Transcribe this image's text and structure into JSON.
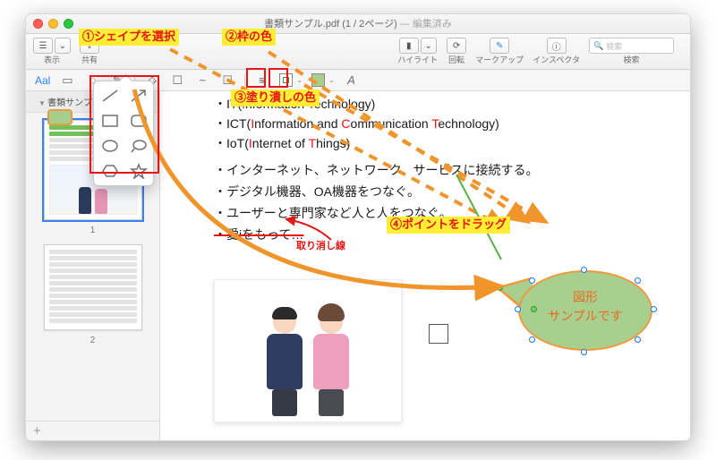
{
  "window": {
    "title_doc": "書類サンプル.pdf",
    "title_pages": "(1 / 2ページ)",
    "title_edited": " — 編集済み"
  },
  "toolbar": {
    "view": "表示",
    "share": "共有",
    "highlight": "ハイライト",
    "rotate": "回転",
    "markup": "マークアップ",
    "inspector": "インスペクタ",
    "search_placeholder": "検索",
    "search_label": "検索"
  },
  "markupbar": {
    "aal": "Aal",
    "font_a": "A"
  },
  "sidebar": {
    "header": "書類サンプル.pdf",
    "pages": [
      "1",
      "2"
    ],
    "add": "+"
  },
  "document": {
    "lines": [
      {
        "pre": "・IT(",
        "r": "I",
        "mid": "nformation ",
        "r2": "T",
        "post": "echnology)"
      },
      {
        "pre": "・ICT(",
        "r": "I",
        "mid": "nformation and ",
        "r2": "C",
        "mid2": "ommunication ",
        "r3": "T",
        "post": "echnology)"
      },
      {
        "pre": "・IoT(",
        "r": "I",
        "mid": "nternet of ",
        "r2": "T",
        "post": "hings)"
      },
      {
        "plain": "・インターネット、ネットワーク、サービスに接続する。"
      },
      {
        "plain": "・デジタル機器、OA機器をつなぐ。"
      },
      {
        "plain": "・ユーザーと専門家など人と人をつなぐ。"
      },
      {
        "strike": "・愛iをもって…"
      }
    ],
    "bubble_line1": "図形",
    "bubble_line2": "サンプルです"
  },
  "shapes_popover": {
    "items": [
      "line",
      "arrow",
      "rect",
      "roundrect",
      "oval",
      "chat",
      "hexagon",
      "star"
    ]
  },
  "annotations": {
    "step1": "①シェイプを選択",
    "step2": "②枠の色",
    "step3": "③塗り潰しの色",
    "step4": "④ポイントをドラッグ",
    "strike_label": "取り消し線"
  }
}
